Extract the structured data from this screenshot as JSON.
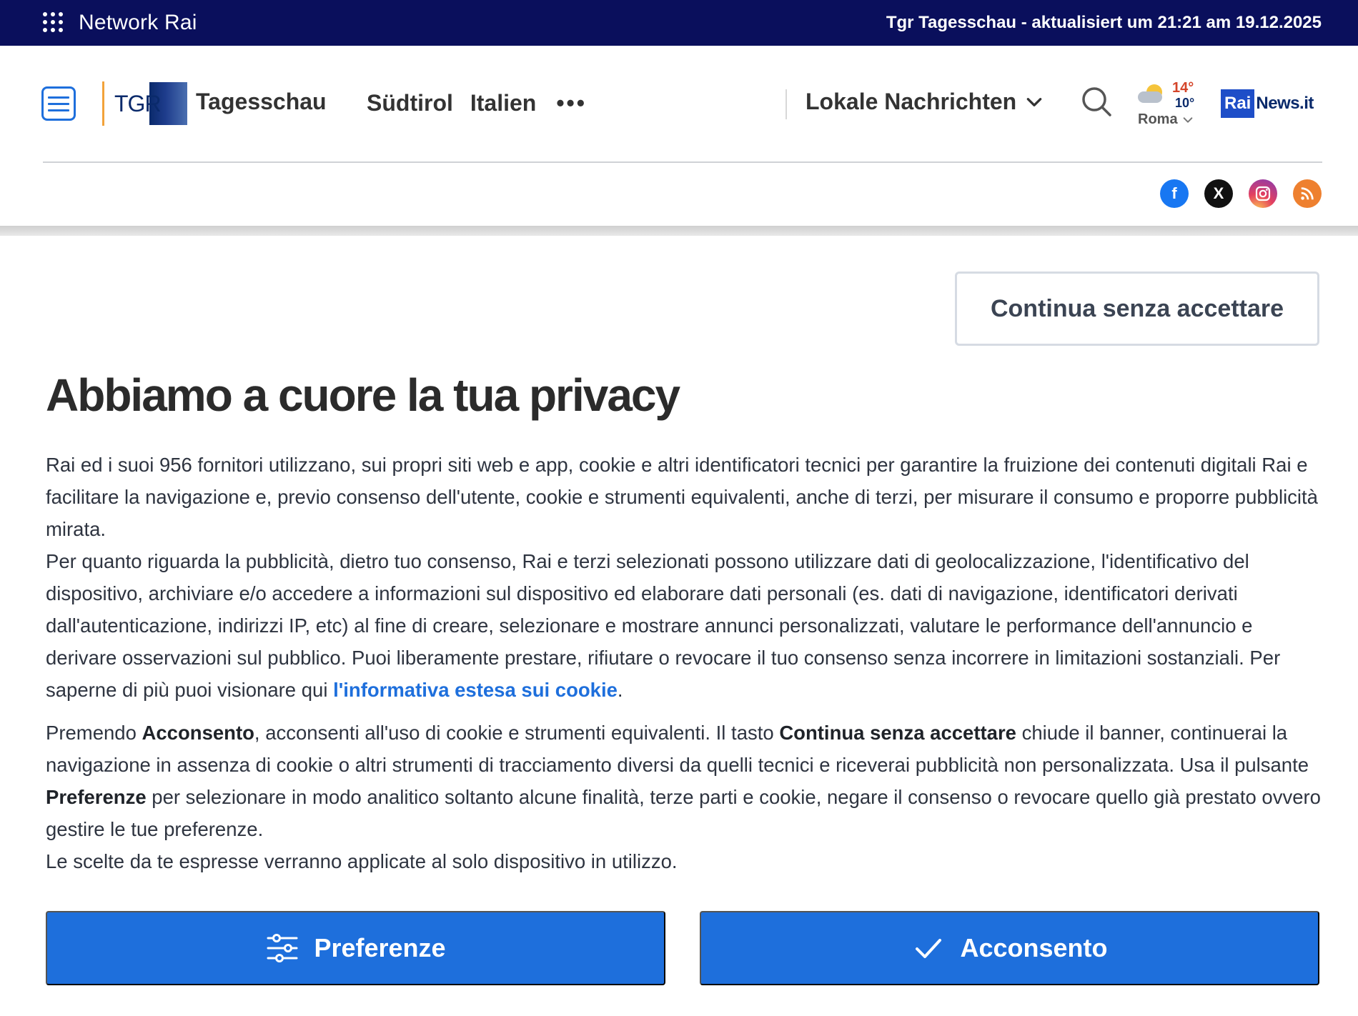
{
  "netbar": {
    "title": "Network Rai",
    "update": "Tgr Tagesschau - aktualisiert um 21:21 am 19.12.2025"
  },
  "header": {
    "logo_text": "Tagesschau",
    "logo_mark": "TGR",
    "nav": [
      "Südtirol",
      "Italien"
    ],
    "nav_more": "•••",
    "lokale": "Lokale Nachrichten",
    "weather": {
      "max": "14°",
      "min": "10°",
      "city": "Roma"
    },
    "rai_box": "Rai",
    "rai_news": "News.it"
  },
  "social": [
    "facebook-icon",
    "x-icon",
    "instagram-icon",
    "rss-icon"
  ],
  "dialog": {
    "continue_label": "Continua senza accettare",
    "title": "Abbiamo a cuore la tua privacy",
    "p1": "Rai ed i suoi 956 fornitori utilizzano, sui propri siti web e app, cookie e altri identificatori tecnici per garantire la fruizione dei contenuti digitali Rai e facilitare la navigazione e, previo consenso dell'utente, cookie e strumenti equivalenti, anche di terzi, per misurare il consumo e proporre pubblicità mirata.",
    "p2": "Per quanto riguarda la pubblicità, dietro tuo consenso, Rai e terzi selezionati possono utilizzare dati di geolocalizzazione, l'identificativo del dispositivo, archiviare e/o accedere a informazioni sul dispositivo ed elaborare dati personali (es. dati di navigazione, identificatori derivati dall'autenticazione, indirizzi IP, etc) al fine di creare, selezionare e mostrare annunci personalizzati, valutare le performance dell'annuncio e derivare osservazioni sul pubblico. Puoi liberamente prestare, rifiutare o revocare il tuo consenso senza incorrere in limitazioni sostanziali. Per saperne di più puoi visionare qui ",
    "p2_link": "l'informativa estesa sui cookie",
    "p2_end": ".",
    "p3_a": "Premendo ",
    "p3_b": "Acconsento",
    "p3_c": ", acconsenti all'uso di cookie e strumenti equivalenti. Il tasto ",
    "p3_d": "Continua senza accettare",
    "p3_e": " chiude il banner, continuerai la navigazione in assenza di cookie o altri strumenti di tracciamento diversi da quelli tecnici e riceverai pubblicità non personalizzata. Usa il pulsante ",
    "p3_f": "Preferenze",
    "p3_g": " per selezionare in modo analitico soltanto alcune finalità, terze parti e cookie, negare il consenso o revocare quello già prestato ovvero gestire le tue preferenze.",
    "p4": "Le scelte da te espresse verranno applicate al solo dispositivo in utilizzo.",
    "pref_label": "Preferenze",
    "accept_label": "Acconsento"
  },
  "colors": {
    "accent": "#1e6fdc",
    "netbar": "#0a0f5c"
  }
}
